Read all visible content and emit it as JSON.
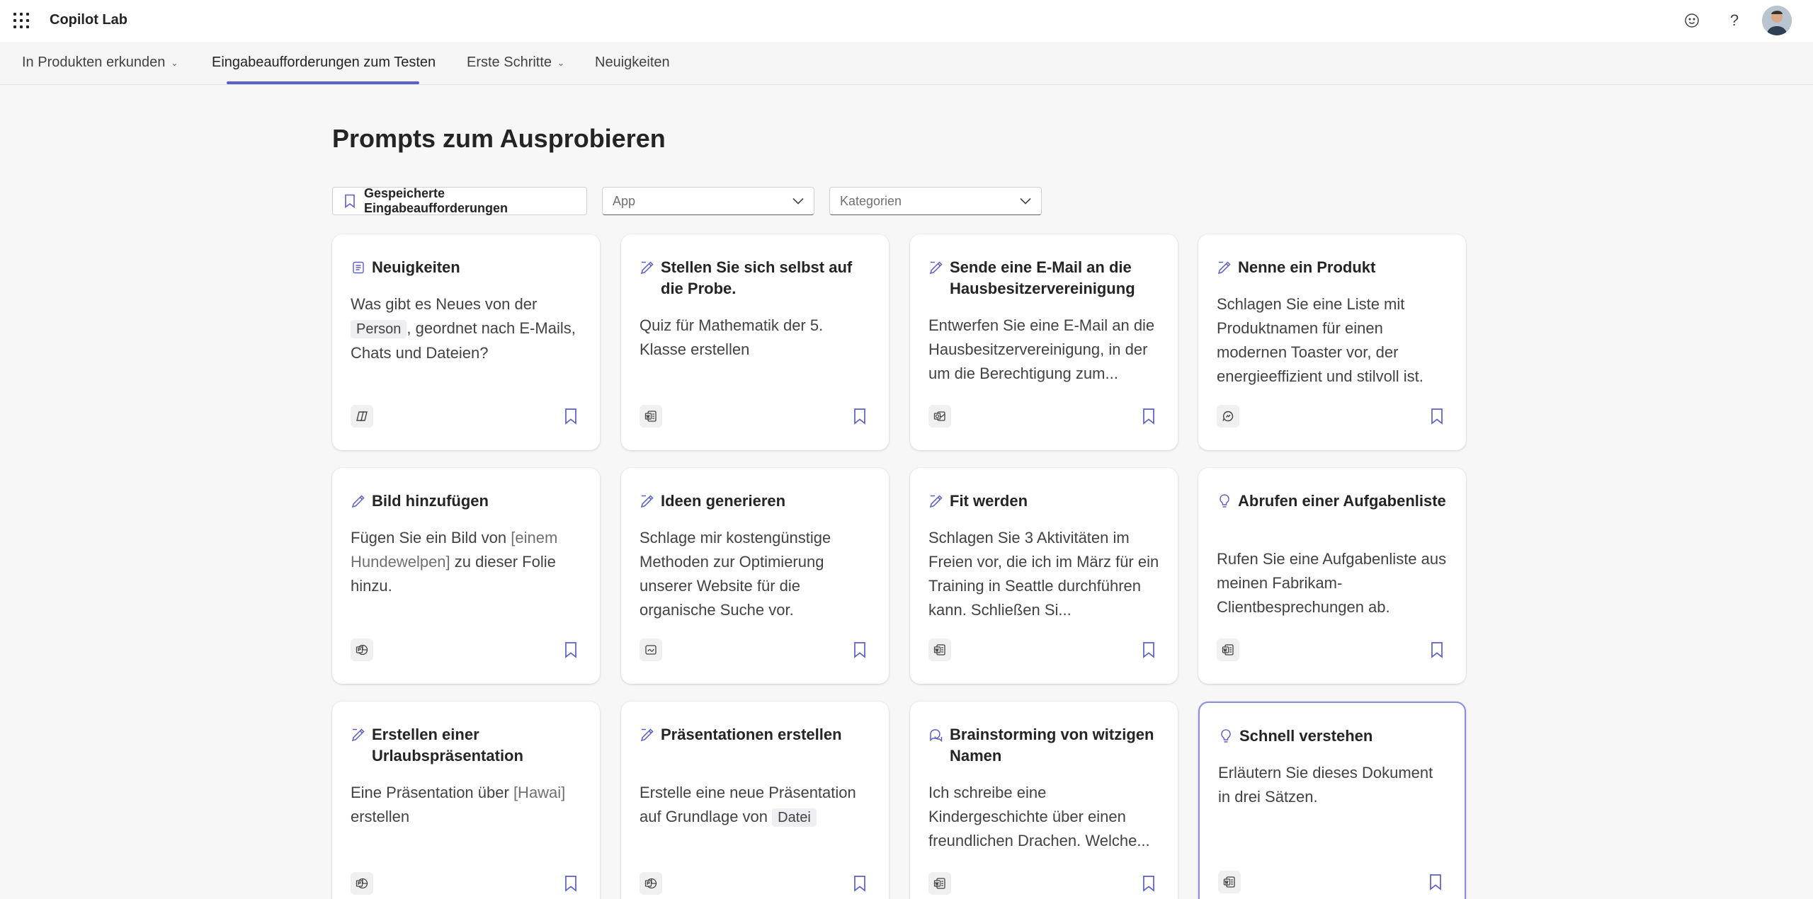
{
  "app": {
    "title": "Copilot Lab"
  },
  "header_icons": [
    "waffle-icon",
    "feedback-smiley-icon",
    "help-icon",
    "avatar"
  ],
  "help_glyph": "?",
  "nav": {
    "items": [
      {
        "label": "In Produkten erkunden",
        "has_chevron": true
      },
      {
        "label": "Eingabeaufforderungen zum Testen",
        "has_chevron": false,
        "active": true
      },
      {
        "label": "Erste Schritte",
        "has_chevron": true
      },
      {
        "label": "Neuigkeiten",
        "has_chevron": false
      }
    ]
  },
  "page": {
    "title": "Prompts zum Ausprobieren"
  },
  "filters": {
    "saved_label": "Gespeicherte Eingabeaufforderungen",
    "app_placeholder": "App",
    "categories_placeholder": "Kategorien"
  },
  "colors": {
    "accent": "#5b5fc7",
    "card_bg": "#ffffff",
    "page_bg": "#f7f7f7"
  },
  "cards": [
    {
      "title": "Neuigkeiten",
      "icon": "list-icon",
      "app_icon": "copilot-app-icon",
      "body_before": "Was gibt es Neues von der ",
      "token": "Person",
      "body_after": ", geordnet nach E-Mails, Chats und Dateien?"
    },
    {
      "title": "Stellen Sie sich selbst auf die Probe.",
      "icon": "create-icon",
      "app_icon": "word-app-icon",
      "body": "Quiz für Mathematik der 5. Klasse erstellen"
    },
    {
      "title": "Sende eine E-Mail an die Hausbesitzervereinigung",
      "icon": "create-icon",
      "app_icon": "outlook-app-icon",
      "body": "Entwerfen Sie eine E-Mail an die Hausbesitzervereinigung, in der um die Berechtigung zum..."
    },
    {
      "title": "Nenne ein Produkt",
      "icon": "create-icon",
      "app_icon": "chat-app-icon",
      "body": "Schlagen Sie eine Liste mit Produktnamen für einen modernen Toaster vor, der energieeffizient und stilvoll ist."
    },
    {
      "title": "Bild hinzufügen",
      "icon": "edit-icon",
      "app_icon": "powerpoint-app-icon",
      "body_before": "Fügen Sie ein Bild von ",
      "placeholder": "[einem Hundewelpen]",
      "body_after": " zu dieser Folie hinzu."
    },
    {
      "title": "Ideen generieren",
      "icon": "create-icon",
      "app_icon": "whiteboard-app-icon",
      "body": "Schlage mir kostengünstige Methoden zur Optimierung unserer Website für die organische Suche vor."
    },
    {
      "title": "Fit werden",
      "icon": "create-icon",
      "app_icon": "word-app-icon",
      "body": "Schlagen Sie 3 Aktivitäten im Freien vor, die ich im März für ein Training in Seattle durchführen kann. Schließen Si..."
    },
    {
      "title": "Abrufen einer Aufgabenliste",
      "icon": "lightbulb-icon",
      "app_icon": "word-app-icon",
      "body": "Rufen Sie eine Aufgabenliste aus meinen Fabrikam-Clientbesprechungen ab."
    },
    {
      "title": "Erstellen einer Urlaubspräsentation",
      "icon": "create-icon",
      "app_icon": "powerpoint-app-icon",
      "body_before": "Eine Präsentation über ",
      "placeholder": "[Hawai]",
      "body_after": " erstellen"
    },
    {
      "title": "Präsentationen erstellen",
      "icon": "create-icon",
      "app_icon": "powerpoint-app-icon",
      "body_before": "Erstelle eine neue Präsentation auf Grundlage von ",
      "token": "Datei",
      "body_after": ""
    },
    {
      "title": "Brainstorming von witzigen Namen",
      "icon": "chat-bubbles-icon",
      "app_icon": "word-app-icon",
      "body": "Ich schreibe eine Kindergeschichte über einen freundlichen Drachen. Welche..."
    },
    {
      "title": "Schnell verstehen",
      "icon": "lightbulb-icon",
      "app_icon": "word-app-icon",
      "selected": true,
      "body": "Erläutern Sie dieses Dokument in drei Sätzen."
    }
  ]
}
